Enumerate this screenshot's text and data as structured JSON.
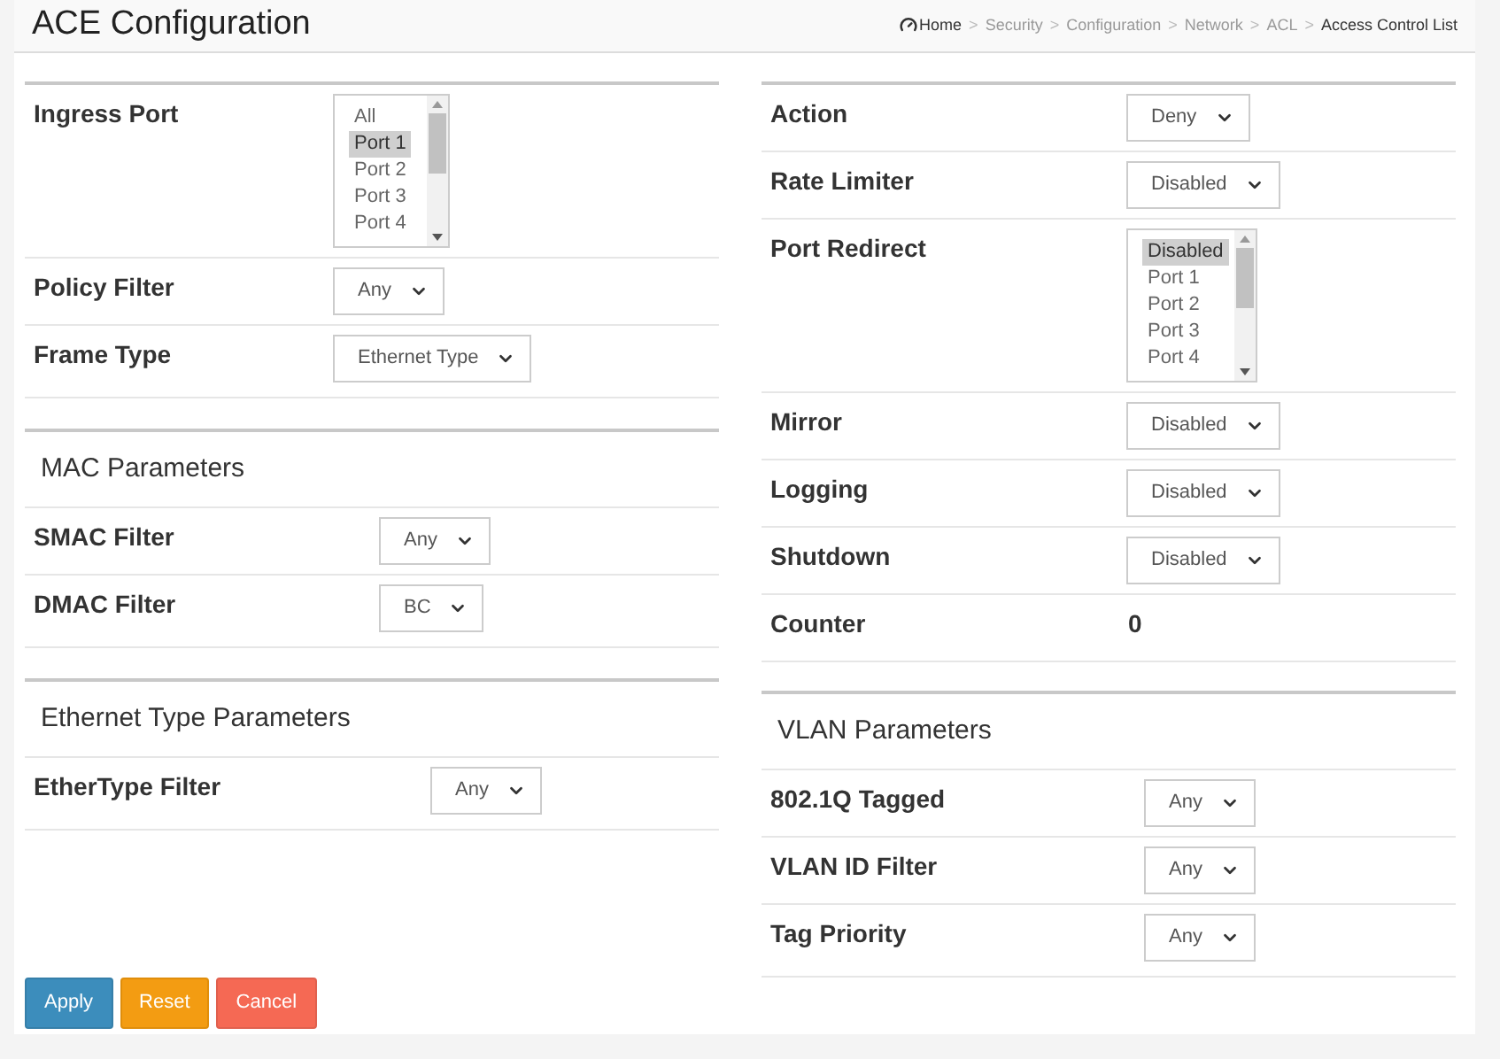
{
  "header": {
    "title": "ACE Configuration",
    "breadcrumb": [
      {
        "label": "Home",
        "kind": "home"
      },
      {
        "label": "Security",
        "kind": "link",
        "separator": ">"
      },
      {
        "label": "Configuration",
        "kind": "link",
        "separator": ">"
      },
      {
        "label": "Network",
        "kind": "link",
        "separator": ">"
      },
      {
        "label": "ACL",
        "kind": "link",
        "separator": ">"
      },
      {
        "label": "Access Control List",
        "kind": "current",
        "separator": ">"
      }
    ]
  },
  "left_panels": [
    {
      "rows": [
        {
          "label": "Ingress Port",
          "kind": "listbox",
          "options": [
            {
              "label": "All",
              "selected": false
            },
            {
              "label": "Port 1",
              "selected": true
            },
            {
              "label": "Port 2",
              "selected": false
            },
            {
              "label": "Port 3",
              "selected": false
            },
            {
              "label": "Port 4",
              "selected": false
            }
          ]
        },
        {
          "label": "Policy Filter",
          "kind": "select",
          "value": "Any"
        },
        {
          "label": "Frame Type",
          "kind": "select",
          "value": "Ethernet Type"
        }
      ]
    },
    {
      "title": "MAC Parameters",
      "rows": [
        {
          "label": "SMAC Filter",
          "kind": "select",
          "value": "Any"
        },
        {
          "label": "DMAC Filter",
          "kind": "select",
          "value": "BC"
        }
      ]
    },
    {
      "title": "Ethernet Type Parameters",
      "rows": [
        {
          "label": "EtherType Filter",
          "kind": "select",
          "value": "Any"
        }
      ]
    }
  ],
  "right_panels": [
    {
      "rows": [
        {
          "label": "Action",
          "kind": "select",
          "value": "Deny"
        },
        {
          "label": "Rate Limiter",
          "kind": "select",
          "value": "Disabled"
        },
        {
          "label": "Port Redirect",
          "kind": "listbox",
          "options": [
            {
              "label": "Disabled",
              "selected": true
            },
            {
              "label": "Port 1",
              "selected": false
            },
            {
              "label": "Port 2",
              "selected": false
            },
            {
              "label": "Port 3",
              "selected": false
            },
            {
              "label": "Port 4",
              "selected": false
            }
          ]
        },
        {
          "label": "Mirror",
          "kind": "select",
          "value": "Disabled"
        },
        {
          "label": "Logging",
          "kind": "select",
          "value": "Disabled"
        },
        {
          "label": "Shutdown",
          "kind": "select",
          "value": "Disabled"
        },
        {
          "label": "Counter",
          "kind": "text",
          "value": "0"
        }
      ]
    },
    {
      "title": "VLAN Parameters",
      "rows": [
        {
          "label": "802.1Q Tagged",
          "kind": "select",
          "value": "Any"
        },
        {
          "label": "VLAN ID Filter",
          "kind": "select",
          "value": "Any"
        },
        {
          "label": "Tag Priority",
          "kind": "select",
          "value": "Any"
        }
      ]
    }
  ],
  "buttons": [
    {
      "label": "Apply",
      "kind": "primary"
    },
    {
      "label": "Reset",
      "kind": "warning"
    },
    {
      "label": "Cancel",
      "kind": "danger"
    }
  ]
}
